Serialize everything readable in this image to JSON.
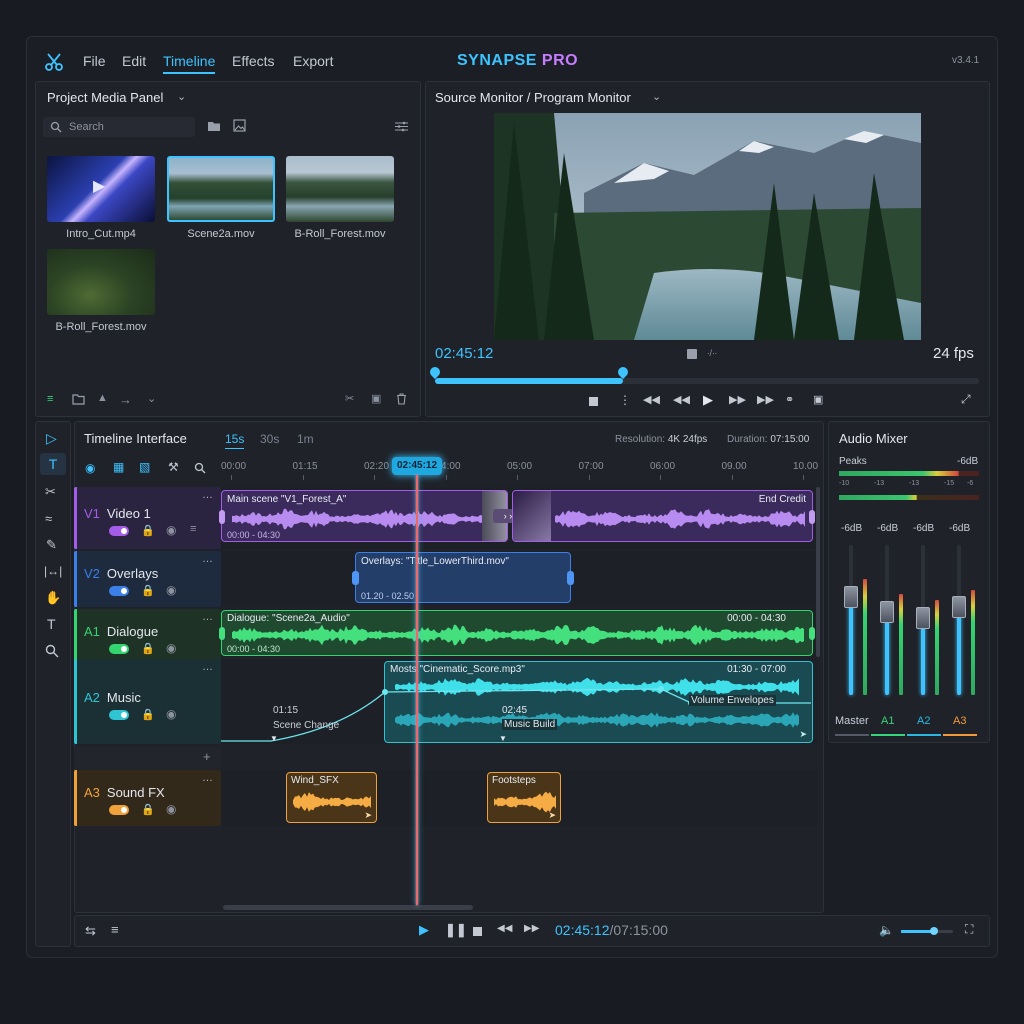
{
  "menu": {
    "file": "File",
    "edit": "Edit",
    "timeline": "Timeline",
    "effects": "Effects",
    "export": "Export"
  },
  "brand": {
    "name": "SYNAPSE",
    "suffix": "PRO",
    "version": "v3.4.1"
  },
  "media_panel": {
    "title": "Project Media Panel",
    "search_placeholder": "Search",
    "items": [
      {
        "name": "Intro_Cut.mp4"
      },
      {
        "name": "Scene2a.mov"
      },
      {
        "name": "B-Roll_Forest.mov"
      },
      {
        "name": "B-Roll_Forest.mov"
      }
    ]
  },
  "monitor": {
    "title": "Source Monitor / Program Monitor",
    "timecode": "02:45:12",
    "fps": "24 fps",
    "mid_label": "∙/∙∙"
  },
  "timeline": {
    "title": "Timeline Interface",
    "zoom": [
      "15s",
      "30s",
      "1m"
    ],
    "resolution_label": "Resolution:",
    "resolution_value": "4K 24fps",
    "duration_label": "Duration:",
    "duration_value": "07:15:00",
    "ruler": [
      "00:00",
      "01:15",
      "02:20",
      "04:00",
      "05:00",
      "07:00",
      "06:00",
      "09.00",
      "10.00"
    ],
    "playhead": "02:45:12",
    "tracks": [
      {
        "id": "V1",
        "name": "Video 1"
      },
      {
        "id": "V2",
        "name": "Overlays"
      },
      {
        "id": "A1",
        "name": "Dialogue"
      },
      {
        "id": "A2",
        "name": "Music"
      },
      {
        "id": "A3",
        "name": "Sound FX"
      }
    ],
    "clips": {
      "v1_main": {
        "title": "Main scene \"V1_Forest_A\"",
        "range": "00:00 - 04:30"
      },
      "v1_end": {
        "title": "End Credit"
      },
      "v2": {
        "title": "Overlays: \"Title_LowerThird.mov\"",
        "range": "01.20 - 02.50"
      },
      "a1": {
        "title": "Dialogue: \"Scene2a_Audio\"",
        "range_left": "00:00 - 04:30",
        "range_right": "00:00 - 04:30"
      },
      "a2": {
        "title": "Mosts \"Cinematic_Score.mp3\"",
        "range": "01:30 - 07:00"
      },
      "a3_wind": {
        "title": "Wind_SFX"
      },
      "a3_foot": {
        "title": "Footsteps"
      }
    },
    "markers": [
      {
        "time": "01:15",
        "label": "Scene Change"
      },
      {
        "time": "02:45",
        "label": "Music Build"
      }
    ],
    "volume_envelopes": "Volume Envelopes"
  },
  "transport": {
    "timecode": "02:45:12",
    "total": "/07:15:00"
  },
  "mixer": {
    "title": "Audio Mixer",
    "peaks": "Peaks",
    "peaks_db": "-6dB",
    "scale": [
      "-10",
      "-13",
      "-13",
      "-15",
      "-6"
    ],
    "channels": [
      {
        "name": "Master",
        "db": "-6dB",
        "level": 0.62,
        "color": "#c9ced8"
      },
      {
        "name": "A1",
        "db": "-6dB",
        "level": 0.52,
        "color": "#36d67a"
      },
      {
        "name": "A2",
        "db": "-6dB",
        "level": 0.48,
        "color": "#2ab8e0"
      },
      {
        "name": "A3",
        "db": "-6dB",
        "level": 0.55,
        "color": "#f29a3a"
      }
    ]
  },
  "colors": {
    "accent": "#3ec3ff",
    "video": "#a45de8",
    "overlay": "#3b7fe8",
    "dialogue": "#34d470",
    "music": "#2ec4d2",
    "sfx": "#f0a23a",
    "playhead": "#ff6b6b"
  }
}
